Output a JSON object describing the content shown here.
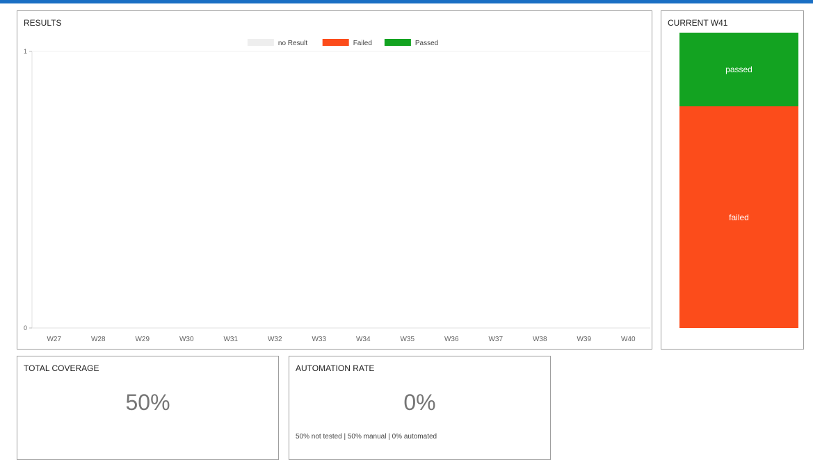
{
  "colors": {
    "topbar": "#1a6fc4",
    "no_result": "#eeeeee",
    "failed": "#fc4c1b",
    "passed": "#13a321"
  },
  "results": {
    "title": "RESULTS",
    "legend": [
      {
        "label": "no Result",
        "color": "#eeeeee"
      },
      {
        "label": "Failed",
        "color": "#fc4c1b"
      },
      {
        "label": "Passed",
        "color": "#13a321"
      }
    ]
  },
  "current": {
    "title": "CURRENT W41",
    "segments": [
      {
        "label": "passed",
        "value": 1,
        "color": "#13a321"
      },
      {
        "label": "failed",
        "value": 3,
        "color": "#fc4c1b"
      }
    ]
  },
  "coverage": {
    "title": "TOTAL COVERAGE",
    "value": "50%"
  },
  "automation": {
    "title": "AUTOMATION RATE",
    "value": "0%",
    "breakdown": "50% not tested | 50% manual | 0% automated"
  },
  "chart_data": [
    {
      "type": "bar",
      "title": "RESULTS",
      "categories": [
        "W27",
        "W28",
        "W29",
        "W30",
        "W31",
        "W32",
        "W33",
        "W34",
        "W35",
        "W36",
        "W37",
        "W38",
        "W39",
        "W40"
      ],
      "series": [
        {
          "name": "no Result",
          "values": [
            0,
            0,
            0,
            0,
            0,
            0,
            0,
            0,
            0,
            0,
            0,
            0,
            0,
            0
          ]
        },
        {
          "name": "Failed",
          "values": [
            0,
            0,
            0,
            0,
            0,
            0,
            0,
            0,
            0,
            0,
            0,
            0,
            0,
            0
          ]
        },
        {
          "name": "Passed",
          "values": [
            0,
            0,
            0,
            0,
            0,
            0,
            0,
            0,
            0,
            0,
            0,
            0,
            0,
            0
          ]
        }
      ],
      "ylim": [
        0,
        1
      ],
      "yticks": [
        "0",
        "1"
      ],
      "stacked": true,
      "grid": false,
      "legend_position": "top-center"
    },
    {
      "type": "bar",
      "title": "CURRENT W41",
      "categories": [
        "W41"
      ],
      "series": [
        {
          "name": "passed",
          "values": [
            1
          ]
        },
        {
          "name": "failed",
          "values": [
            3
          ]
        }
      ],
      "stacked": true,
      "normalized": true
    }
  ]
}
